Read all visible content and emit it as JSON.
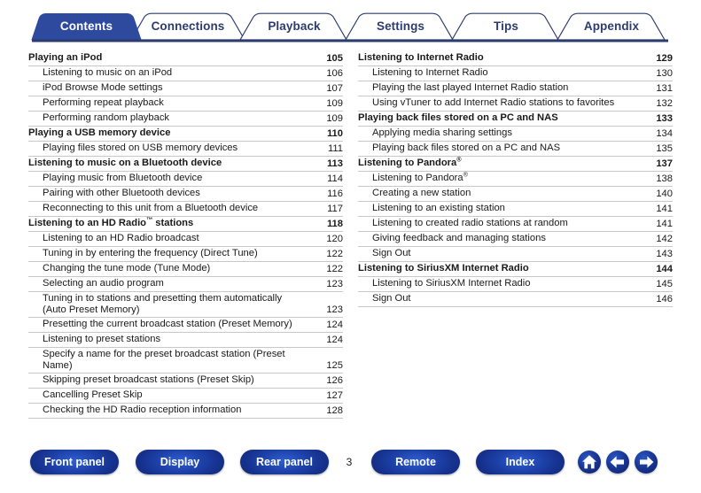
{
  "document": {
    "page_number": "3",
    "accent_navy": "#2d3c6e",
    "active_tab_fill": "#2e4a9e",
    "pill_blue": "#1d40a8",
    "row_rule": "#c8c8c8"
  },
  "tabs": [
    {
      "label": "Contents",
      "active": true
    },
    {
      "label": "Connections",
      "active": false
    },
    {
      "label": "Playback",
      "active": false
    },
    {
      "label": "Settings",
      "active": false
    },
    {
      "label": "Tips",
      "active": false
    },
    {
      "label": "Appendix",
      "active": false
    }
  ],
  "toc": {
    "left_column": [
      {
        "level": 1,
        "title": "Playing an iPod",
        "page": "105"
      },
      {
        "level": 2,
        "title": "Listening to music on an iPod",
        "page": "106"
      },
      {
        "level": 2,
        "title": "iPod Browse Mode settings",
        "page": "107"
      },
      {
        "level": 2,
        "title": "Performing repeat playback",
        "page": "109"
      },
      {
        "level": 2,
        "title": "Performing random playback",
        "page": "109"
      },
      {
        "level": 1,
        "title": "Playing a USB memory device",
        "page": "110"
      },
      {
        "level": 2,
        "title": "Playing files stored on USB memory devices",
        "page": "111"
      },
      {
        "level": 1,
        "title": "Listening to music on a Bluetooth device",
        "page": "113"
      },
      {
        "level": 2,
        "title": "Playing music from Bluetooth device",
        "page": "114"
      },
      {
        "level": 2,
        "title": "Pairing with other Bluetooth devices",
        "page": "116"
      },
      {
        "level": 2,
        "title": "Reconnecting to this unit from a Bluetooth device",
        "page": "117"
      },
      {
        "level": 1,
        "title": "Listening to an HD Radio™ stations",
        "page": "118",
        "trademark": "™"
      },
      {
        "level": 2,
        "title": "Listening to an HD Radio broadcast",
        "page": "120"
      },
      {
        "level": 2,
        "title": "Tuning in by entering the frequency (Direct Tune)",
        "page": "122"
      },
      {
        "level": 2,
        "title": "Changing the tune mode (Tune Mode)",
        "page": "122"
      },
      {
        "level": 2,
        "title": "Selecting an audio program",
        "page": "123"
      },
      {
        "level": 2,
        "title": "Tuning in to stations and presetting them automatically (Auto Preset Memory)",
        "page": "123"
      },
      {
        "level": 2,
        "title": "Presetting the current broadcast station (Preset Memory)",
        "page": "124"
      },
      {
        "level": 2,
        "title": "Listening to preset stations",
        "page": "124"
      },
      {
        "level": 2,
        "title": "Specify a name for the preset broadcast station (Preset Name)",
        "page": "125"
      },
      {
        "level": 2,
        "title": "Skipping preset broadcast stations (Preset Skip)",
        "page": "126"
      },
      {
        "level": 2,
        "title": "Cancelling Preset Skip",
        "page": "127"
      },
      {
        "level": 2,
        "title": "Checking the HD Radio reception information",
        "page": "128"
      }
    ],
    "right_column": [
      {
        "level": 1,
        "title": "Listening to Internet Radio",
        "page": "129"
      },
      {
        "level": 2,
        "title": "Listening to Internet Radio",
        "page": "130"
      },
      {
        "level": 2,
        "title": "Playing the last played Internet Radio station",
        "page": "131"
      },
      {
        "level": 2,
        "title": "Using vTuner to add Internet Radio stations to favorites",
        "page": "132"
      },
      {
        "level": 1,
        "title": "Playing back files stored on a PC and NAS",
        "page": "133"
      },
      {
        "level": 2,
        "title": "Applying media sharing settings",
        "page": "134"
      },
      {
        "level": 2,
        "title": "Playing back files stored on a PC and NAS",
        "page": "135"
      },
      {
        "level": 1,
        "title": "Listening to Pandora®",
        "page": "137",
        "trademark": "®"
      },
      {
        "level": 2,
        "title": "Listening to Pandora®",
        "page": "138",
        "trademark": "®"
      },
      {
        "level": 2,
        "title": "Creating a new station",
        "page": "140"
      },
      {
        "level": 2,
        "title": "Listening to an existing station",
        "page": "141"
      },
      {
        "level": 2,
        "title": "Listening to created radio stations at random",
        "page": "141"
      },
      {
        "level": 2,
        "title": "Giving feedback and managing stations",
        "page": "142"
      },
      {
        "level": 2,
        "title": "Sign Out",
        "page": "143"
      },
      {
        "level": 1,
        "title": "Listening to SiriusXM Internet Radio",
        "page": "144"
      },
      {
        "level": 2,
        "title": "Listening to SiriusXM Internet Radio",
        "page": "145"
      },
      {
        "level": 2,
        "title": "Sign Out",
        "page": "146"
      }
    ]
  },
  "footer": {
    "buttons": [
      {
        "label": "Front panel"
      },
      {
        "label": "Display"
      },
      {
        "label": "Rear panel"
      },
      {
        "label": "Remote"
      },
      {
        "label": "Index"
      }
    ],
    "nav_icons": [
      {
        "name": "home-icon"
      },
      {
        "name": "arrow-left-icon"
      },
      {
        "name": "arrow-right-icon"
      }
    ]
  }
}
